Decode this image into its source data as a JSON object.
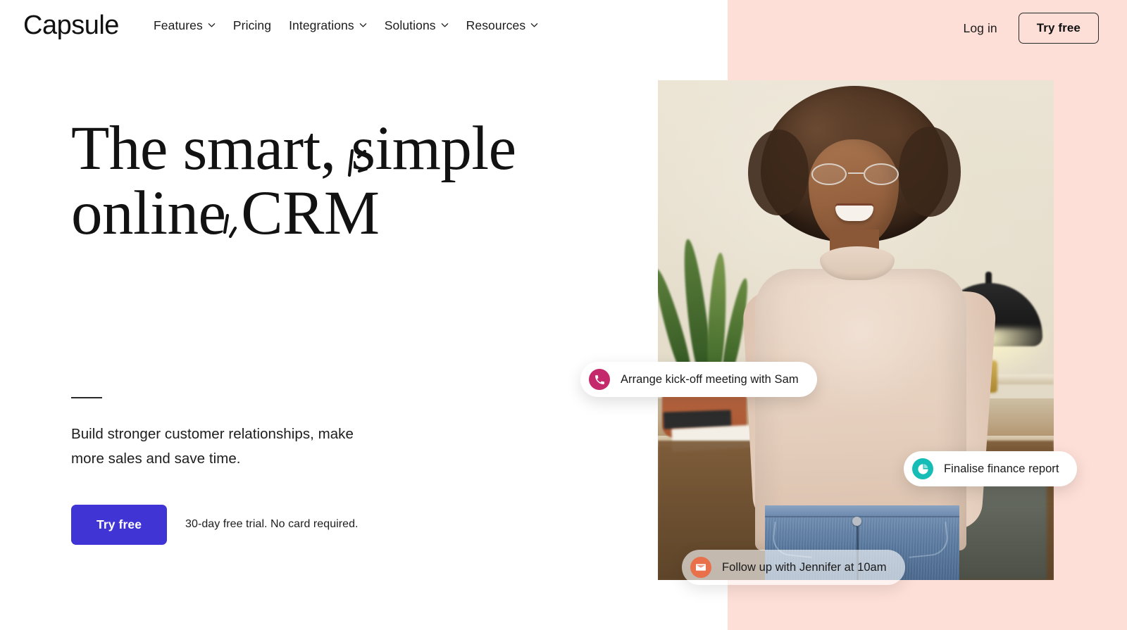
{
  "brand": {
    "logo_text": "Capsule",
    "accent_blue": "#4034d4",
    "panel_pink": "#fddfd7"
  },
  "header": {
    "nav": [
      {
        "label": "Features",
        "has_dropdown": true
      },
      {
        "label": "Pricing",
        "has_dropdown": false
      },
      {
        "label": "Integrations",
        "has_dropdown": true
      },
      {
        "label": "Solutions",
        "has_dropdown": true
      },
      {
        "label": "Resources",
        "has_dropdown": true
      }
    ],
    "login_label": "Log in",
    "try_free_label": "Try free"
  },
  "hero": {
    "title_line1": "The smart, simple",
    "title_line2": "online CRM",
    "subtitle": "Build stronger customer relationships, make more sales and save time.",
    "cta_label": "Try free",
    "cta_note": "30-day free trial. No card required."
  },
  "notifications": [
    {
      "id": "pill-call",
      "label": "Arrange kick-off meeting with Sam",
      "icon": "phone-icon",
      "icon_color": "#c42a6b"
    },
    {
      "id": "pill-finance",
      "label": "Finalise finance report",
      "icon": "pie-chart-icon",
      "icon_color": "#15bdb6"
    },
    {
      "id": "pill-email",
      "label": "Follow up with Jennifer at 10am",
      "icon": "envelope-icon",
      "icon_color": "#e8714c"
    }
  ]
}
